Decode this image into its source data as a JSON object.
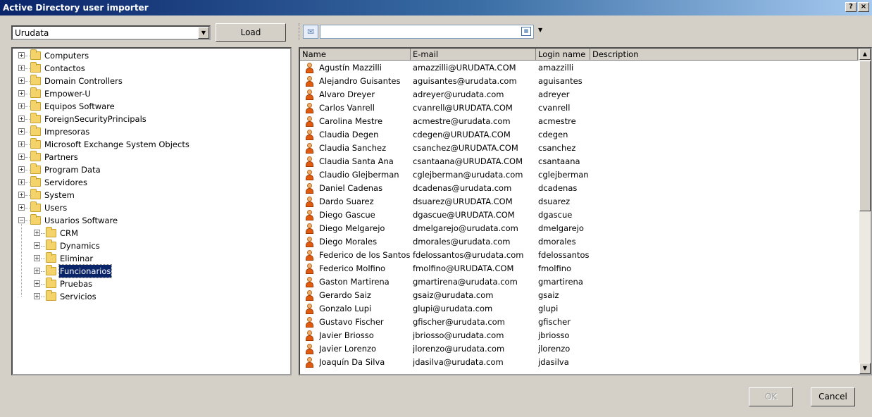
{
  "window": {
    "title": "Active Directory user importer",
    "help_label": "?",
    "close_label": "×"
  },
  "domain_combo": {
    "value": "Urudata"
  },
  "load_button": "Load",
  "tree": {
    "items": [
      {
        "label": "Computers",
        "level": 0,
        "expander": "+"
      },
      {
        "label": "Contactos",
        "level": 0,
        "expander": "+"
      },
      {
        "label": "Domain Controllers",
        "level": 0,
        "expander": "+"
      },
      {
        "label": "Empower-U",
        "level": 0,
        "expander": "+"
      },
      {
        "label": "Equipos Software",
        "level": 0,
        "expander": "+"
      },
      {
        "label": "ForeignSecurityPrincipals",
        "level": 0,
        "expander": "+"
      },
      {
        "label": "Impresoras",
        "level": 0,
        "expander": "+"
      },
      {
        "label": "Microsoft Exchange System Objects",
        "level": 0,
        "expander": "+"
      },
      {
        "label": "Partners",
        "level": 0,
        "expander": "+"
      },
      {
        "label": "Program Data",
        "level": 0,
        "expander": "+"
      },
      {
        "label": "Servidores",
        "level": 0,
        "expander": "+"
      },
      {
        "label": "System",
        "level": 0,
        "expander": "+"
      },
      {
        "label": "Users",
        "level": 0,
        "expander": "+"
      },
      {
        "label": "Usuarios Software",
        "level": 0,
        "expander": "−"
      },
      {
        "label": "CRM",
        "level": 1,
        "expander": "+"
      },
      {
        "label": "Dynamics",
        "level": 1,
        "expander": "+"
      },
      {
        "label": "Eliminar",
        "level": 1,
        "expander": "+"
      },
      {
        "label": "Funcionarios",
        "level": 1,
        "expander": "+",
        "selected": true
      },
      {
        "label": "Pruebas",
        "level": 1,
        "expander": "+"
      },
      {
        "label": "Servicios",
        "level": 1,
        "expander": "+"
      }
    ]
  },
  "toolbar": {
    "search_value": "",
    "dropdown_glyph": "▼"
  },
  "grid": {
    "columns": [
      "Name",
      "E-mail",
      "Login name",
      "Description"
    ],
    "rows": [
      {
        "name": "Agustín Mazzilli",
        "email": "amazzilli@URUDATA.COM",
        "login": "amazzilli",
        "description": ""
      },
      {
        "name": "Alejandro Guisantes",
        "email": "aguisantes@urudata.com",
        "login": "aguisantes",
        "description": ""
      },
      {
        "name": "Alvaro Dreyer",
        "email": "adreyer@urudata.com",
        "login": "adreyer",
        "description": ""
      },
      {
        "name": "Carlos Vanrell",
        "email": "cvanrell@URUDATA.COM",
        "login": "cvanrell",
        "description": ""
      },
      {
        "name": "Carolina Mestre",
        "email": "acmestre@urudata.com",
        "login": "acmestre",
        "description": ""
      },
      {
        "name": "Claudia Degen",
        "email": "cdegen@URUDATA.COM",
        "login": "cdegen",
        "description": ""
      },
      {
        "name": "Claudia Sanchez",
        "email": "csanchez@URUDATA.COM",
        "login": "csanchez",
        "description": ""
      },
      {
        "name": "Claudia Santa Ana",
        "email": "csantaana@URUDATA.COM",
        "login": "csantaana",
        "description": ""
      },
      {
        "name": "Claudio Glejberman",
        "email": "cglejberman@urudata.com",
        "login": "cglejberman",
        "description": ""
      },
      {
        "name": "Daniel Cadenas",
        "email": "dcadenas@urudata.com",
        "login": "dcadenas",
        "description": ""
      },
      {
        "name": "Dardo Suarez",
        "email": "dsuarez@URUDATA.COM",
        "login": "dsuarez",
        "description": ""
      },
      {
        "name": "Diego Gascue",
        "email": "dgascue@URUDATA.COM",
        "login": "dgascue",
        "description": ""
      },
      {
        "name": "Diego Melgarejo",
        "email": "dmelgarejo@urudata.com",
        "login": "dmelgarejo",
        "description": ""
      },
      {
        "name": "Diego Morales",
        "email": "dmorales@urudata.com",
        "login": "dmorales",
        "description": ""
      },
      {
        "name": "Federico de los Santos",
        "email": "fdelossantos@urudata.com",
        "login": "fdelossantos",
        "description": ""
      },
      {
        "name": "Federico Molfino",
        "email": "fmolfino@URUDATA.COM",
        "login": "fmolfino",
        "description": ""
      },
      {
        "name": "Gaston Martirena",
        "email": "gmartirena@urudata.com",
        "login": "gmartirena",
        "description": ""
      },
      {
        "name": "Gerardo Saiz",
        "email": "gsaiz@urudata.com",
        "login": "gsaiz",
        "description": ""
      },
      {
        "name": "Gonzalo Lupi",
        "email": "glupi@urudata.com",
        "login": "glupi",
        "description": ""
      },
      {
        "name": "Gustavo Fischer",
        "email": "gfischer@urudata.com",
        "login": "gfischer",
        "description": ""
      },
      {
        "name": "Javier Briosso",
        "email": "jbriosso@urudata.com",
        "login": "jbriosso",
        "description": ""
      },
      {
        "name": "Javier Lorenzo",
        "email": "jlorenzo@urudata.com",
        "login": "jlorenzo",
        "description": ""
      },
      {
        "name": "Joaquín Da Silva",
        "email": "jdasilva@urudata.com",
        "login": "jdasilva",
        "description": ""
      }
    ]
  },
  "footer": {
    "ok_label": "OK",
    "cancel_label": "Cancel"
  },
  "icons": {
    "folder": "folder-icon",
    "user": "user-icon",
    "mail": "envelope-icon",
    "calendar": "calendar-icon"
  },
  "colors": {
    "title_gradient_start": "#0a246a",
    "selection": "#0a246a",
    "window_bg": "#d4d0c8"
  }
}
